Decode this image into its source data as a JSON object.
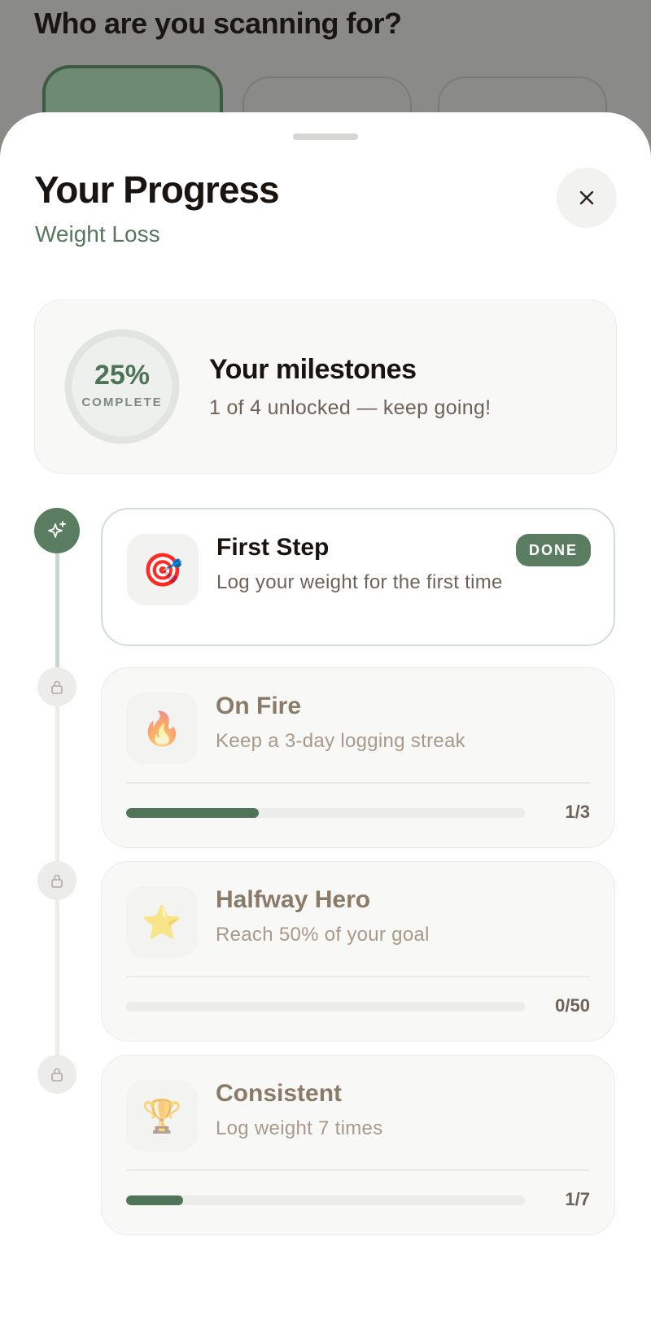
{
  "background_page": {
    "title": "Who are you scanning for?"
  },
  "sheet": {
    "title": "Your Progress",
    "subtitle": "Weight Loss",
    "close_icon": "close-icon"
  },
  "summary": {
    "percent": "25%",
    "percent_label": "COMPLETE",
    "progress_fraction": 0.25,
    "title": "Your milestones",
    "subtitle": "1 of 4 unlocked — keep going!"
  },
  "milestones": [
    {
      "title": "First Step",
      "description": "Log your weight for the first time",
      "icon": "🎯",
      "icon_name": "target-icon",
      "status": "done",
      "badge": "DONE"
    },
    {
      "title": "On Fire",
      "description": "Keep a 3-day logging streak",
      "icon": "🔥",
      "icon_name": "fire-icon",
      "status": "locked",
      "progress_label": "1/3",
      "progress_fraction": 0.333
    },
    {
      "title": "Halfway Hero",
      "description": "Reach 50% of your goal",
      "icon": "⭐",
      "icon_name": "star-icon",
      "status": "locked",
      "progress_label": "0/50",
      "progress_fraction": 0
    },
    {
      "title": "Consistent",
      "description": "Log weight 7 times",
      "icon": "🏆",
      "icon_name": "trophy-icon",
      "status": "locked",
      "progress_label": "1/7",
      "progress_fraction": 0.143
    }
  ],
  "colors": {
    "accent": "#5a7c61",
    "progress_fill": "#4f7458",
    "title_text": "#1a1410",
    "locked_title": "#8a7a68"
  }
}
